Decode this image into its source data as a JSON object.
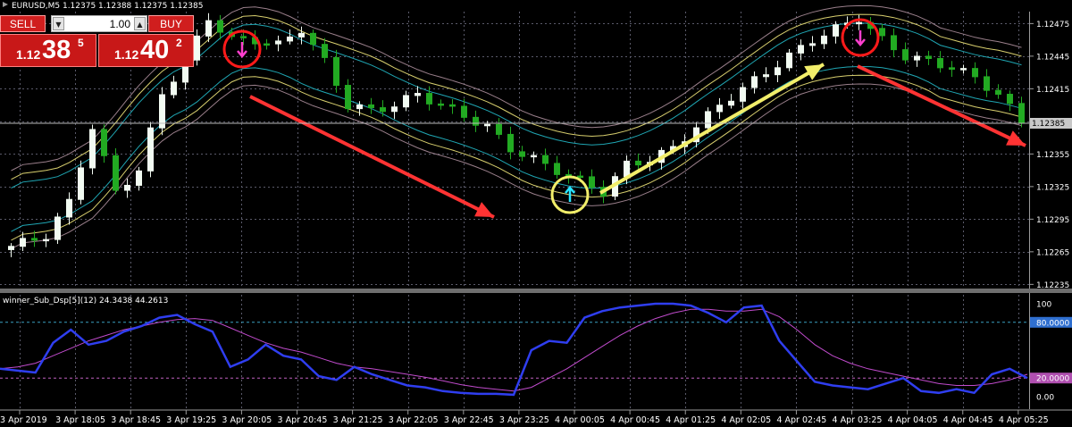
{
  "symbol_line": "EURUSD,M5  1.12375 1.12388 1.12375 1.12385",
  "trade_panel": {
    "sell_label": "SELL",
    "buy_label": "BUY",
    "lot": "1.00",
    "sell_price_prefix": "1.12",
    "sell_price_main": "38",
    "sell_price_sup": "5",
    "buy_price_prefix": "1.12",
    "buy_price_main": "40",
    "buy_price_sup": "2"
  },
  "current_price_label": "1.12385",
  "indicator_label": "winner_Sub_Dsp[5](12) 24.3438 44.2613",
  "colors": {
    "background": "#000000",
    "grid": "#5a5a6a",
    "bull_candle": "#f2fbf2",
    "bear_candle": "#22aa22",
    "envelope_yellow": "#d8cf6e",
    "envelope_cyan": "#1fa6b3",
    "envelope_mauve": "#9a7f8b",
    "sell_arrow": "#ff3333",
    "buy_arrow": "#f2ee6a",
    "osc_fast": "#2f3ef0",
    "osc_slow": "#c04bcc",
    "level_80": "#3aa0c0",
    "level_20": "#c060c0"
  },
  "annotations": [
    {
      "type": "sell-signal",
      "icon": "pink-down-arrow",
      "circle": "red"
    },
    {
      "type": "buy-signal",
      "icon": "cyan-up-arrow",
      "circle": "yellow"
    },
    {
      "type": "sell-signal",
      "icon": "pink-down-arrow",
      "circle": "red"
    }
  ],
  "chart_data": [
    {
      "type": "candlestick",
      "title": "EURUSD,M5",
      "y_ticks": [
        "1.12475",
        "1.12445",
        "1.12415",
        "1.12385",
        "1.12355",
        "1.12325",
        "1.12295",
        "1.12265",
        "1.12235"
      ],
      "ylim": [
        1.12232,
        1.12486
      ],
      "x_ticks": [
        "3 Apr 2019",
        "3 Apr 18:05",
        "3 Apr 18:45",
        "3 Apr 19:25",
        "3 Apr 20:05",
        "3 Apr 20:45",
        "3 Apr 21:25",
        "3 Apr 22:05",
        "3 Apr 22:45",
        "3 Apr 23:25",
        "4 Apr 00:05",
        "4 Apr 00:45",
        "4 Apr 01:25",
        "4 Apr 02:05",
        "4 Apr 02:45",
        "4 Apr 03:25",
        "4 Apr 04:05",
        "4 Apr 04:45",
        "4 Apr 05:25"
      ],
      "close_anchors": [
        [
          0,
          1.1227
        ],
        [
          3,
          1.1228
        ],
        [
          5,
          1.1231
        ],
        [
          7,
          1.1238
        ],
        [
          9,
          1.1232
        ],
        [
          11,
          1.1234
        ],
        [
          13,
          1.1241
        ],
        [
          15,
          1.1244
        ],
        [
          17,
          1.1248
        ],
        [
          19,
          1.1246
        ],
        [
          21,
          1.1246
        ],
        [
          23,
          1.12455
        ],
        [
          25,
          1.1247
        ],
        [
          27,
          1.1244
        ],
        [
          29,
          1.124
        ],
        [
          31,
          1.12395
        ],
        [
          33,
          1.124
        ],
        [
          35,
          1.1241
        ],
        [
          37,
          1.124
        ],
        [
          39,
          1.1239
        ],
        [
          41,
          1.1238
        ],
        [
          43,
          1.1236
        ],
        [
          45,
          1.1235
        ],
        [
          47,
          1.1234
        ],
        [
          49,
          1.1233
        ],
        [
          51,
          1.1232
        ],
        [
          53,
          1.12345
        ],
        [
          55,
          1.1235
        ],
        [
          57,
          1.1236
        ],
        [
          59,
          1.1238
        ],
        [
          61,
          1.124
        ],
        [
          63,
          1.12415
        ],
        [
          65,
          1.1243
        ],
        [
          67,
          1.12445
        ],
        [
          69,
          1.1246
        ],
        [
          71,
          1.1247
        ],
        [
          73,
          1.1248
        ],
        [
          75,
          1.1246
        ],
        [
          77,
          1.12445
        ],
        [
          79,
          1.1244
        ],
        [
          81,
          1.12435
        ],
        [
          83,
          1.12425
        ],
        [
          85,
          1.1241
        ],
        [
          87,
          1.12385
        ]
      ],
      "envelopes": [
        "yellow",
        "cyan",
        "mauve"
      ]
    },
    {
      "type": "line",
      "title": "winner_Sub_Dsp[5](12) 24.3438 44.2613",
      "ylim": [
        0,
        100
      ],
      "y_ticks": [
        "100",
        "80.0000",
        "20.0000",
        "0.00"
      ],
      "levels": [
        80,
        20
      ],
      "series": [
        {
          "values": [
            30,
            28,
            26,
            58,
            72,
            56,
            60,
            70,
            76,
            85,
            88,
            78,
            70,
            32,
            40,
            56,
            44,
            40,
            22,
            18,
            32,
            24,
            18,
            12,
            10,
            6,
            4,
            3,
            3,
            2,
            50,
            60,
            58,
            85,
            92,
            96,
            98,
            100,
            100,
            98,
            90,
            80,
            96,
            98,
            60,
            38,
            16,
            12,
            10,
            8,
            14,
            20,
            6,
            4,
            8,
            4,
            24,
            30,
            20
          ]
        },
        {
          "values": [
            30,
            32,
            36,
            44,
            52,
            60,
            66,
            72,
            76,
            80,
            83,
            84,
            82,
            74,
            66,
            58,
            52,
            48,
            42,
            36,
            32,
            30,
            27,
            24,
            21,
            17,
            13,
            10,
            8,
            6,
            10,
            20,
            30,
            42,
            54,
            66,
            76,
            84,
            90,
            94,
            94,
            92,
            92,
            94,
            86,
            72,
            56,
            44,
            36,
            30,
            26,
            22,
            18,
            14,
            12,
            12,
            14,
            18,
            24
          ]
        }
      ]
    }
  ]
}
